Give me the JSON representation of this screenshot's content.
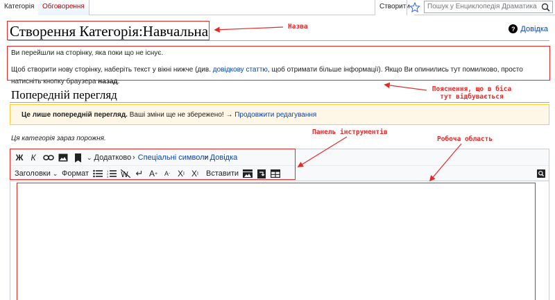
{
  "tabs": {
    "category": "Категорія",
    "talk": "Обговорення",
    "create": "Створити"
  },
  "search": {
    "placeholder": "Пошук у Енциклопедія Драматика"
  },
  "page": {
    "title": "Створення Категорія:Навчальна",
    "help_link": "Довідка"
  },
  "info": {
    "line1": "Ви перейшли на сторінку, яка поки що не існує.",
    "line2_before": "Щоб створити нову сторінку, наберіть текст у вікні нижче (див. ",
    "line2_link": "довідкову статтю",
    "line2_after": ", щоб отримати більше інформації). Якщо Ви опинились тут помилково, просто натисніть кнопку браузера ",
    "line2_bold": "назад",
    "line2_end": "."
  },
  "preview": {
    "heading": "Попередній перегляд",
    "notice_bold": "Це лише попередній перегляд.",
    "notice_text": " Ваші зміни ще не збережено! → ",
    "notice_link": "Продовжити редагування",
    "empty_category": "Ця категорія зараз порожня."
  },
  "toolbar": {
    "bold": "Ж",
    "italic": "К",
    "advanced": "Додатково",
    "special_chars": "Спеціальні символи",
    "help": "Довідка",
    "headings": "Заголовки",
    "format": "Формат",
    "insert": "Вставити",
    "icons": [
      "link-icon",
      "image-icon",
      "reference-icon",
      "bulleted-list-icon",
      "numbered-list-icon",
      "nowiki-icon",
      "newline-icon",
      "big-text-icon",
      "small-text-icon",
      "superscript-icon",
      "subscript-icon",
      "gallery-icon",
      "redirect-icon",
      "table-icon",
      "search-replace-icon"
    ]
  },
  "editor": {
    "content": ""
  },
  "annotations": {
    "title_label": "Назва",
    "explanation_label_1": "Пояснення, що в біса",
    "explanation_label_2": "тут відбувається",
    "toolbar_label": "Панель інструментів",
    "workspace_label": "Робоча область",
    "color": "#e52a2a"
  }
}
